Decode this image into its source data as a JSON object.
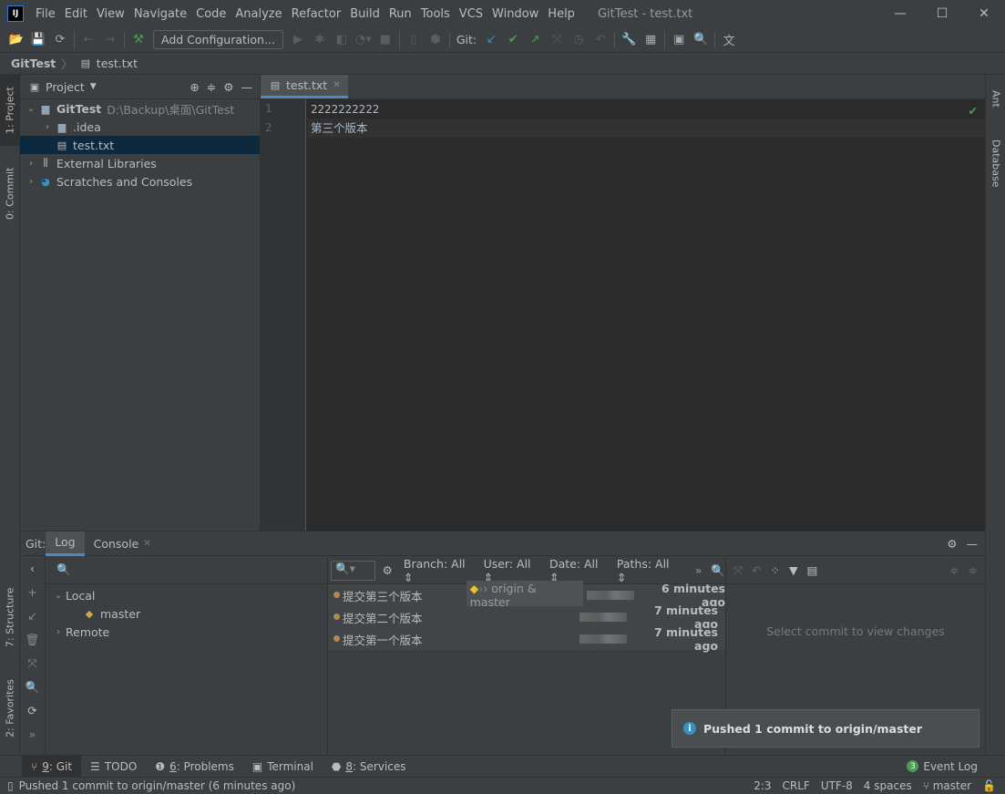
{
  "window": {
    "title": "GitTest - test.txt",
    "logo": "IJ"
  },
  "menu": [
    "File",
    "Edit",
    "View",
    "Navigate",
    "Code",
    "Analyze",
    "Refactor",
    "Build",
    "Run",
    "Tools",
    "VCS",
    "Window",
    "Help"
  ],
  "toolbar": {
    "add_config": "Add Configuration...",
    "git_label": "Git:"
  },
  "breadcrumb": {
    "project": "GitTest",
    "file": "test.txt"
  },
  "left_tabs": {
    "project": "1: Project",
    "commit": "0: Commit",
    "structure": "7: Structure",
    "favorites": "2: Favorites"
  },
  "right_tabs": {
    "ant": "Ant",
    "database": "Database"
  },
  "project_panel": {
    "title": "Project",
    "tree": [
      {
        "label": "GitTest",
        "extra": "D:\\Backup\\桌面\\GitTest"
      },
      {
        "label": ".idea"
      },
      {
        "label": "test.txt"
      },
      {
        "label": "External Libraries"
      },
      {
        "label": "Scratches and Consoles"
      }
    ]
  },
  "editor": {
    "tab": "test.txt",
    "lines": [
      "2222222222",
      "第三个版本"
    ],
    "line_numbers": [
      "1",
      "2"
    ]
  },
  "git_panel": {
    "label": "Git:",
    "tabs": [
      "Log",
      "Console"
    ],
    "branches": {
      "local": "Local",
      "master": "master",
      "remote": "Remote"
    },
    "filters": {
      "branch": "Branch: All",
      "user": "User: All",
      "date": "Date: All",
      "paths": "Paths: All"
    },
    "commits": [
      {
        "message": "提交第三个版本",
        "tag": "origin & master",
        "time": "6 minutes ago"
      },
      {
        "message": "提交第二个版本",
        "time": "7 minutes ago"
      },
      {
        "message": "提交第一个版本",
        "time": "7 minutes ago"
      }
    ],
    "changes_placeholder": "Select commit to view changes"
  },
  "notification": "Pushed 1 commit to origin/master",
  "tool_windows": [
    {
      "key": "9",
      "label": ": Git"
    },
    {
      "label": "TODO"
    },
    {
      "key": "6",
      "label": ": Problems"
    },
    {
      "label": "Terminal"
    },
    {
      "key": "8",
      "label": ": Services"
    }
  ],
  "event_log": {
    "count": "3",
    "label": "Event Log"
  },
  "status": {
    "message": "Pushed 1 commit to origin/master (6 minutes ago)",
    "position": "2:3",
    "line_sep": "CRLF",
    "encoding": "UTF-8",
    "indent": "4 spaces",
    "branch": "master"
  }
}
